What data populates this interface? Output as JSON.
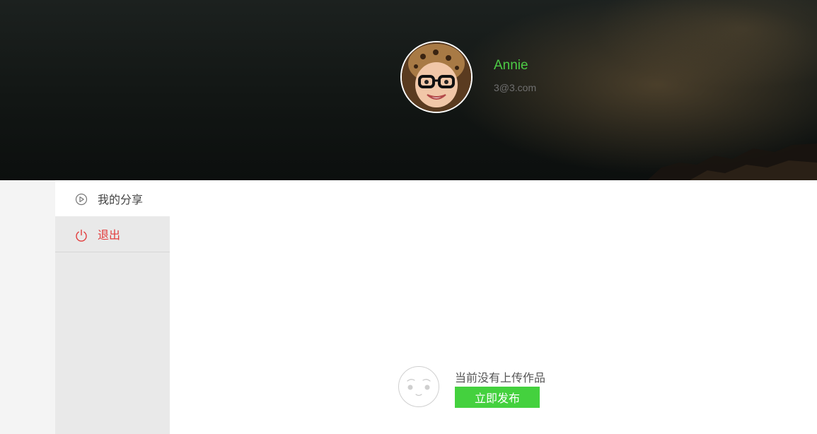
{
  "profile": {
    "name": "Annie",
    "email": "3@3.com"
  },
  "sidebar": {
    "items": [
      {
        "label": "我的分享",
        "icon": "play-circle-icon"
      },
      {
        "label": "退出",
        "icon": "power-icon"
      }
    ]
  },
  "main": {
    "empty_message": "当前没有上传作品",
    "publish_label": "立即发布"
  },
  "colors": {
    "accent_green": "#44d13e",
    "name_green": "#4ccb45",
    "logout_red": "#e23b3b"
  }
}
